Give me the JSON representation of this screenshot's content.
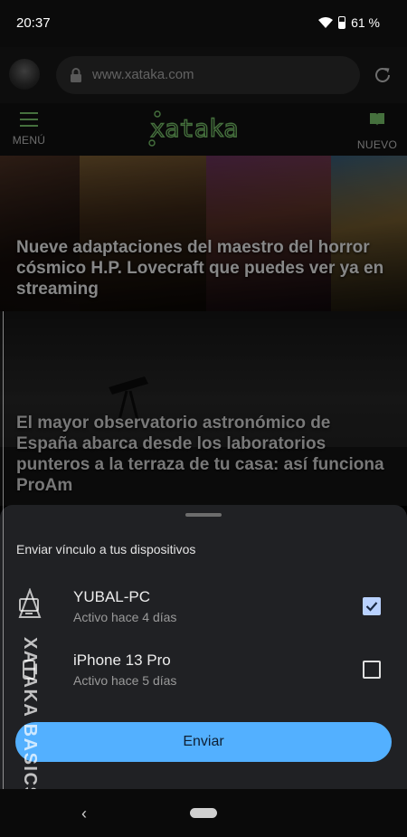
{
  "status_bar": {
    "time": "20:37",
    "battery": "61 %",
    "icons": [
      "wifi-icon",
      "battery-icon"
    ]
  },
  "browser": {
    "url": "www.xataka.com",
    "icons": [
      "lock-icon",
      "reload-icon"
    ]
  },
  "site_header": {
    "menu_label": "MENÚ",
    "logo": "xataka",
    "nuevo_label": "NUEVO",
    "accent": "#78c16a"
  },
  "articles": [
    {
      "headline": "Nueve adaptaciones del maestro del horror cósmico H.P. Lovecraft que puedes ver ya en streaming"
    },
    {
      "headline": "El mayor observatorio astronómico de España abarca desde los laboratorios punteros a la terraza de tu casa: así funciona ProAm"
    }
  ],
  "sheet": {
    "title": "Enviar vínculo a tus dispositivos",
    "devices": [
      {
        "name": "YUBAL-PC",
        "status": "Activo hace 4 días",
        "checked": true,
        "icon": "computer-icon"
      },
      {
        "name": "iPhone 13 Pro",
        "status": "Activo hace 5 días",
        "checked": false,
        "icon": "phone-icon"
      }
    ],
    "send_label": "Enviar",
    "button_color": "#53b0ff"
  },
  "watermark": "XATAKA BASICS"
}
